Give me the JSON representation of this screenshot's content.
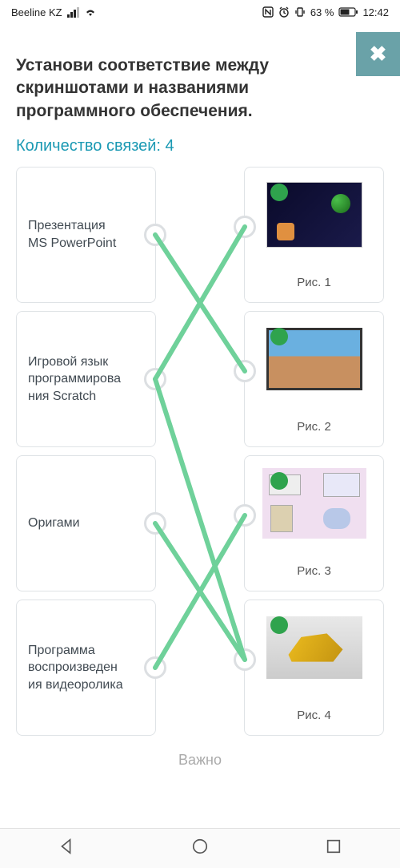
{
  "status_bar": {
    "carrier": "Beeline KZ",
    "battery_text": "63 %",
    "time": "12:42"
  },
  "close_glyph": "✖",
  "title": "Установи соответствие между скриншотами и названиями программного обеспечения.",
  "subtitle_prefix": "Количество связей: ",
  "subtitle_count": "4",
  "left_items": [
    "Презентация MS PowerPoint",
    "Игровой язык программирования Scratch",
    "Оригами",
    "Программа воспроизведения видеоролика"
  ],
  "right_items": [
    "Рис. 1",
    "Рис. 2",
    "Рис. 3",
    "Рис. 4"
  ],
  "connections": [
    {
      "from": 0,
      "to": 1
    },
    {
      "from": 1,
      "to": 0
    },
    {
      "from": 1,
      "to": 3
    },
    {
      "from": 2,
      "to": 3
    },
    {
      "from": 3,
      "to": 2
    }
  ],
  "footer_partial": "Важно",
  "colors": {
    "accent": "#1a99b3",
    "line": "#6fd19a",
    "close_bg": "#6aa2a8"
  }
}
